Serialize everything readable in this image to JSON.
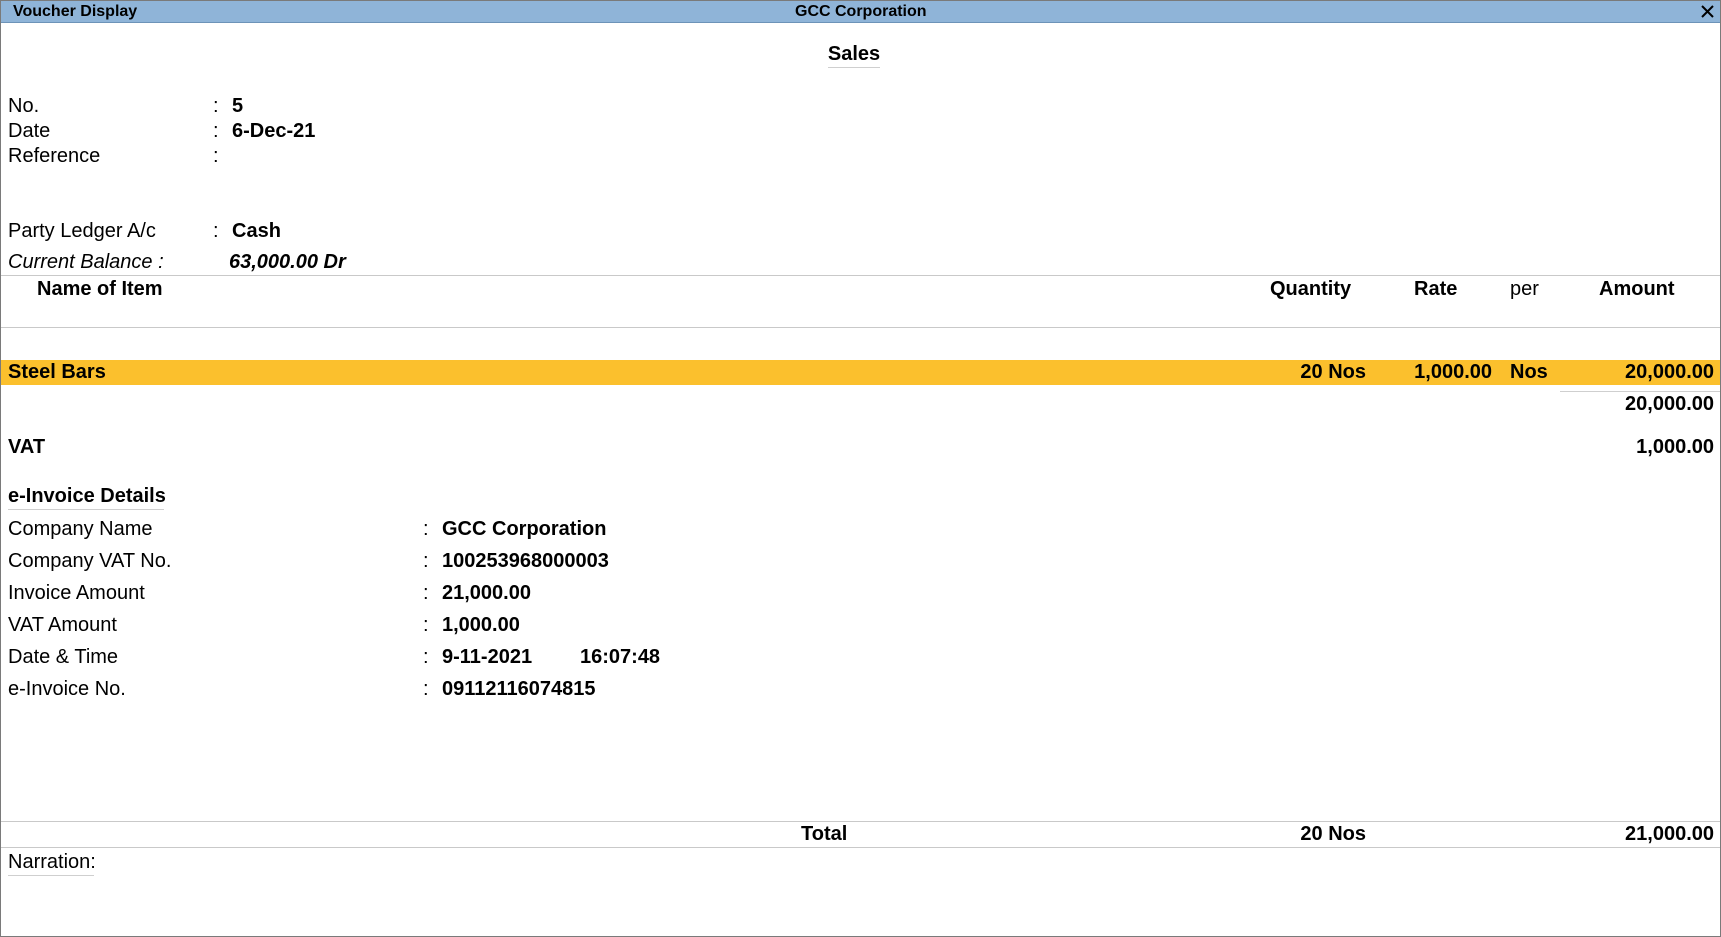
{
  "window": {
    "title": "Voucher Display",
    "company": "GCC Corporation",
    "close_icon": "close-icon"
  },
  "voucher": {
    "type": "Sales",
    "fields": [
      {
        "label": "No.",
        "value": "5"
      },
      {
        "label": "Date",
        "value": "6-Dec-21"
      },
      {
        "label": "Reference",
        "value": ""
      }
    ],
    "party_label": "Party Ledger A/c",
    "party_value": "Cash",
    "balance_label": "Current Balance :",
    "balance_value": "63,000.00 Dr"
  },
  "table": {
    "headers": {
      "name": "Name of Item",
      "quantity": "Quantity",
      "rate": "Rate",
      "per": "per",
      "amount": "Amount"
    },
    "items": [
      {
        "name": "Steel Bars",
        "quantity": "20 Nos",
        "rate": "1,000.00",
        "per": "Nos",
        "amount": "20,000.00"
      }
    ],
    "subtotal": "20,000.00",
    "vat_label": "VAT",
    "vat_amount": "1,000.00"
  },
  "einvoice": {
    "heading": "e-Invoice Details",
    "rows": [
      {
        "label": "Company Name",
        "value": "GCC Corporation"
      },
      {
        "label": "Company VAT No.",
        "value": "100253968000003"
      },
      {
        "label": "Invoice Amount",
        "value": "21,000.00"
      },
      {
        "label": "VAT Amount",
        "value": "1,000.00"
      },
      {
        "label": "Date & Time",
        "value": "9-11-2021"
      },
      {
        "label": "e-Invoice No.",
        "value": "09112116074815"
      }
    ],
    "time": "16:07:48"
  },
  "total": {
    "label": "Total",
    "quantity": "20 Nos",
    "amount": "21,000.00"
  },
  "narration": {
    "label": "Narration:"
  },
  "colors": {
    "titlebar": "#8fb4d8",
    "selected_row": "#fbc02d"
  }
}
